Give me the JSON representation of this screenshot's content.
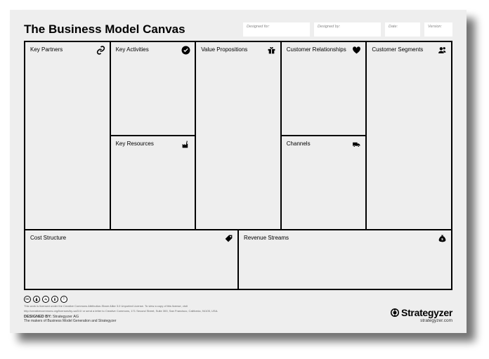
{
  "title": "The Business Model Canvas",
  "meta": {
    "designed_for_label": "Designed for:",
    "designed_by_label": "Designed by:",
    "date_label": "Date:",
    "version_label": "Version:"
  },
  "blocks": {
    "key_partners": "Key Partners",
    "key_activities": "Key Activities",
    "key_resources": "Key Resources",
    "value_propositions": "Value Propositions",
    "customer_relationships": "Customer Relationships",
    "channels": "Channels",
    "customer_segments": "Customer Segments",
    "cost_structure": "Cost Structure",
    "revenue_streams": "Revenue Streams"
  },
  "footer": {
    "license_line1": "This work is licensed under the Creative Commons Attribution-Share Alike 3.0 Unported License. To view a copy of this license, visit",
    "license_line2": "http://creativecommons.org/licenses/by-sa/3.0/ or send a letter to Creative Commons, 171 Second Street, Suite 300, San Francisco, California, 94105, USA.",
    "designed_by_label": "DESIGNED BY:",
    "designed_by_value": "Strategyzer AG",
    "tagline": "The makers of Business Model Generation and Strategyzer",
    "brand_name": "Strategyzer",
    "brand_url": "strategyzer.com"
  }
}
